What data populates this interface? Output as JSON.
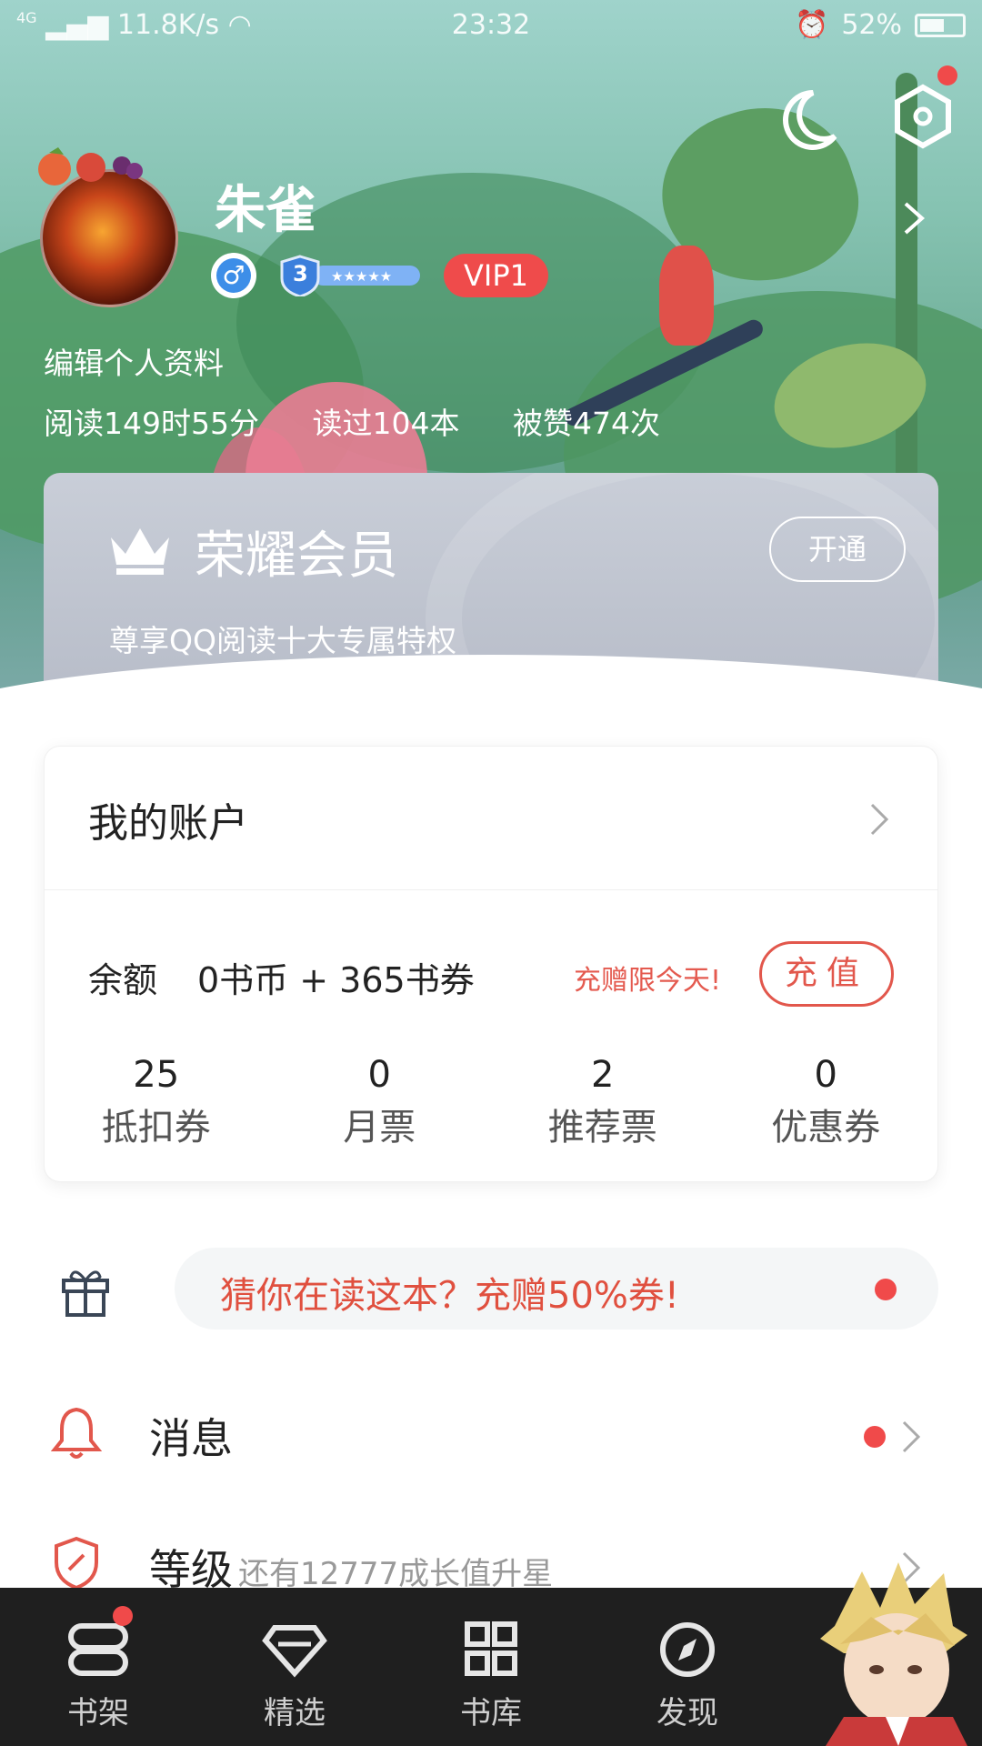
{
  "status_bar": {
    "network": "4G",
    "speed": "11.8K/s",
    "time": "23:32",
    "battery": "52%"
  },
  "profile": {
    "username": "朱雀",
    "level_number": "3",
    "vip_label": "VIP1",
    "edit_label": "编辑个人资料",
    "stats": {
      "reading_time": "阅读149时55分",
      "books_read": "读过104本",
      "likes": "被赞474次"
    }
  },
  "vip_card": {
    "title": "荣耀会员",
    "description": "尊享QQ阅读十大专属特权",
    "button_label": "开通"
  },
  "account": {
    "title": "我的账户",
    "balance_label": "余额",
    "balance_value": "0书币 + 365书券",
    "promo_text": "充赠限今天!",
    "recharge_label": "充值",
    "tickets": [
      {
        "count": "25",
        "label": "抵扣券"
      },
      {
        "count": "0",
        "label": "月票"
      },
      {
        "count": "2",
        "label": "推荐票"
      },
      {
        "count": "0",
        "label": "优惠券"
      }
    ]
  },
  "banner": {
    "text": "猜你在读这本？充赠50%券!"
  },
  "menu": {
    "messages_label": "消息",
    "level_label": "等级",
    "level_sub": "还有12777成长值升星"
  },
  "tabbar": {
    "tabs": [
      {
        "label": "书架",
        "icon": "bookshelf-icon"
      },
      {
        "label": "精选",
        "icon": "diamond-icon"
      },
      {
        "label": "书库",
        "icon": "grid-icon"
      },
      {
        "label": "发现",
        "icon": "compass-icon"
      }
    ]
  },
  "colors": {
    "accent_red": "#e2574c",
    "tabbar_bg": "#1f1f1f",
    "vip_badge": "#ef4b4b"
  }
}
